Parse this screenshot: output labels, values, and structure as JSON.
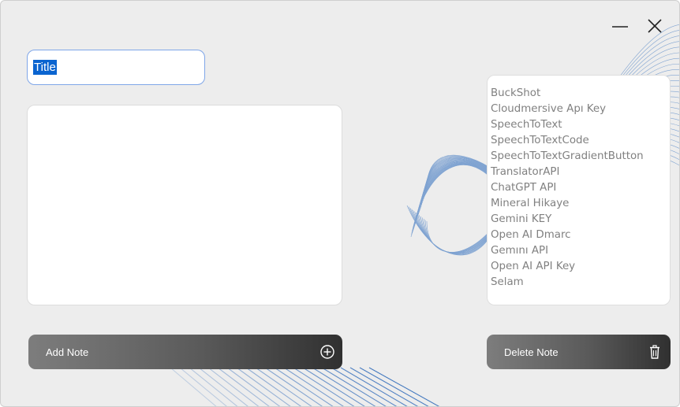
{
  "window": {
    "minimize_icon": "minimize-icon",
    "close_icon": "close-icon"
  },
  "editor": {
    "title_value": "Title",
    "body_value": ""
  },
  "notes": [
    "BuckShot",
    "Cloudmersive Apı Key",
    "SpeechToText",
    "SpeechToTextCode",
    "SpeechToTextGradientButton",
    "TranslatorAPI",
    "ChatGPT API",
    "Mineral Hikaye",
    "Gemini KEY",
    "Open AI Dmarc",
    "Gemını API",
    "Open AI API Key",
    "Selam"
  ],
  "actions": {
    "add_label": "Add Note",
    "add_icon": "plus-circle-icon",
    "delete_label": "Delete Note",
    "delete_icon": "trash-icon"
  },
  "colors": {
    "background": "#ededed",
    "input_border": "#7fa6e8",
    "selection": "#0a64d0",
    "button_gradient_start": "#7d7d7d",
    "button_gradient_end": "#303030",
    "deco_lines": "#1f5fb5"
  }
}
